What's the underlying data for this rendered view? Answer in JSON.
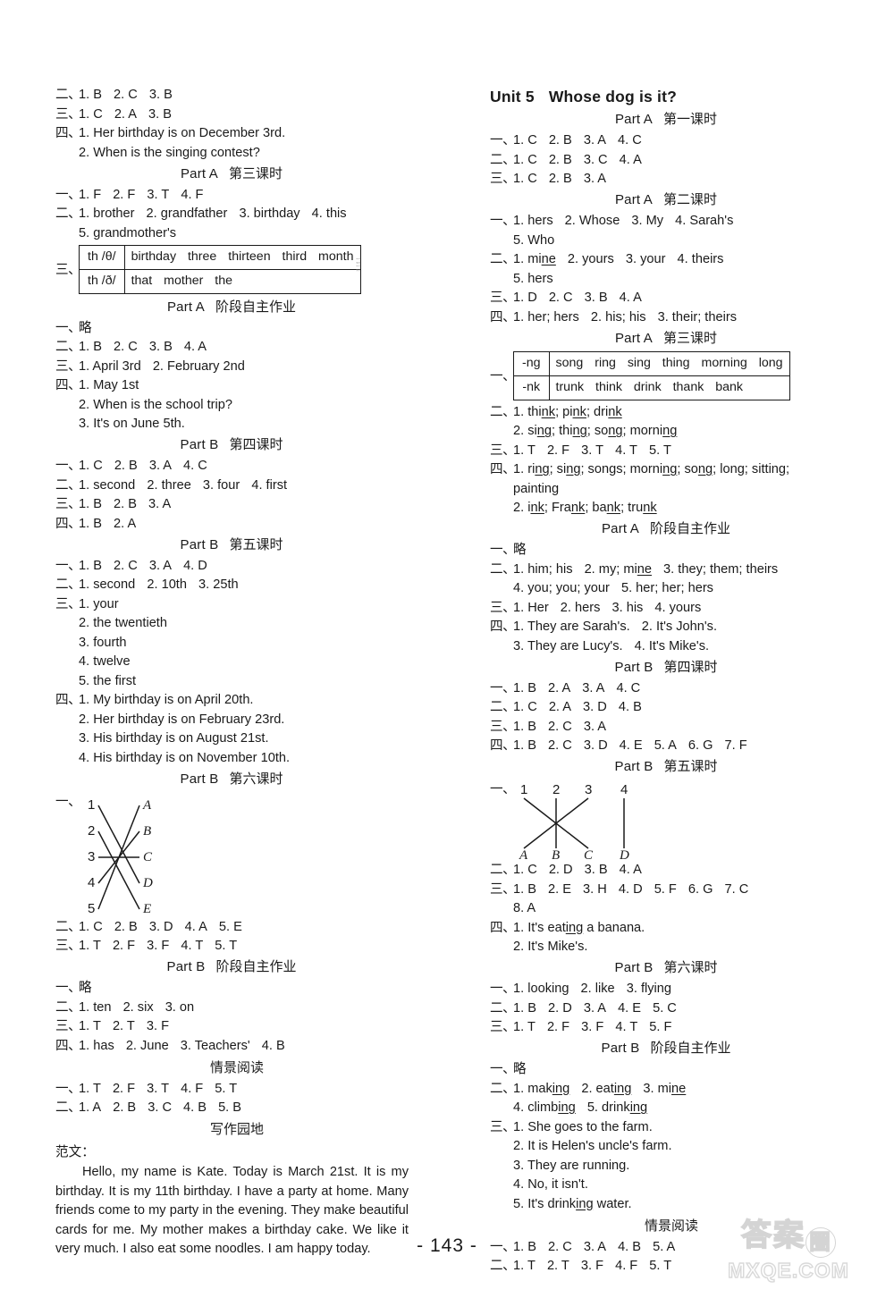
{
  "page": {
    "number": "- 143 -",
    "watermark_cn": "答案",
    "watermark_circle": "圈",
    "watermark_en": "MXQE.COM"
  },
  "left_column": {
    "blocks": [
      {
        "type": "line",
        "num": "二、",
        "text": "1. B  2. C  3. B"
      },
      {
        "type": "line",
        "num": "三、",
        "text": "1. C  2. A  3. B"
      },
      {
        "type": "line",
        "num": "四、",
        "text": "1. Her birthday is on December 3rd."
      },
      {
        "type": "line",
        "num": "",
        "text": "2. When is the singing contest?"
      },
      {
        "type": "part",
        "part": "Part A",
        "cn": "第三课时"
      },
      {
        "type": "line",
        "num": "一、",
        "text": "1. F  2. F  3. T  4. F"
      },
      {
        "type": "line",
        "num": "二、",
        "text": "1. brother  2. grandfather  3. birthday  4. this"
      },
      {
        "type": "line",
        "num": "",
        "text": "5. grandmother's"
      },
      {
        "type": "table",
        "num": "三、",
        "rows": [
          {
            "key": "th /θ/",
            "words": "birthday   three   thirteen   third month"
          },
          {
            "key": "th /ð/",
            "words": "that   mother   the"
          }
        ]
      },
      {
        "type": "part",
        "part": "Part A",
        "cn": "阶段自主作业"
      },
      {
        "type": "line",
        "num": "一、",
        "text": "略"
      },
      {
        "type": "line",
        "num": "二、",
        "text": "1. B  2. C  3. B  4. A"
      },
      {
        "type": "line",
        "num": "三、",
        "text": "1. April 3rd   2. February 2nd"
      },
      {
        "type": "line",
        "num": "四、",
        "text": "1. May 1st"
      },
      {
        "type": "line",
        "num": "",
        "text": "2. When is the school trip?"
      },
      {
        "type": "line",
        "num": "",
        "text": "3. It's on June 5th."
      },
      {
        "type": "part",
        "part": "Part B",
        "cn": "第四课时"
      },
      {
        "type": "line",
        "num": "一、",
        "text": "1. C  2. B  3. A  4. C"
      },
      {
        "type": "line",
        "num": "二、",
        "text": "1. second  2. three  3. four  4. first"
      },
      {
        "type": "line",
        "num": "三、",
        "text": "1. B  2. B  3. A"
      },
      {
        "type": "line",
        "num": "四、",
        "text": "1. B  2. A"
      },
      {
        "type": "part",
        "part": "Part B",
        "cn": "第五课时"
      },
      {
        "type": "line",
        "num": "一、",
        "text": "1. B  2. C  3. A  4. D"
      },
      {
        "type": "line",
        "num": "二、",
        "text": "1. second  2. 10th  3. 25th"
      },
      {
        "type": "line",
        "num": "三、",
        "text": "1. your"
      },
      {
        "type": "line",
        "num": "",
        "text": "2. the twentieth"
      },
      {
        "type": "line",
        "num": "",
        "text": "3. fourth"
      },
      {
        "type": "line",
        "num": "",
        "text": "4. twelve"
      },
      {
        "type": "line",
        "num": "",
        "text": "5. the first"
      },
      {
        "type": "line",
        "num": "四、",
        "text": "1. My birthday is on April 20th."
      },
      {
        "type": "line",
        "num": "",
        "text": "2. Her birthday is on February 23rd."
      },
      {
        "type": "line",
        "num": "",
        "text": "3. His birthday is on August 21st."
      },
      {
        "type": "line",
        "num": "",
        "text": "4. His birthday is on November 10th."
      },
      {
        "type": "part",
        "part": "Part B",
        "cn": "第六课时"
      },
      {
        "type": "match_left",
        "num": "一、"
      },
      {
        "type": "line",
        "num": "二、",
        "text": "1. C  2. B  3. D  4. A  5. E"
      },
      {
        "type": "line",
        "num": "三、",
        "text": "1. T  2. F  3. F  4. T  5. T"
      },
      {
        "type": "part",
        "part": "Part B",
        "cn": "阶段自主作业"
      },
      {
        "type": "line",
        "num": "一、",
        "text": "略"
      },
      {
        "type": "line",
        "num": "二、",
        "text": "1. ten  2. six  3. on"
      },
      {
        "type": "line",
        "num": "三、",
        "text": "1. T  2. T  3. F"
      },
      {
        "type": "line",
        "num": "四、",
        "text": "1. has  2. June  3. Teachers'  4. B"
      },
      {
        "type": "section",
        "title": "情景阅读"
      },
      {
        "type": "line",
        "num": "一、",
        "text": "1. T  2. F  3. T  4. F  5. T"
      },
      {
        "type": "line",
        "num": "二、",
        "text": "1. A  2. B  3. C  4. B  5. B"
      },
      {
        "type": "section",
        "title": "写作园地"
      },
      {
        "type": "fanwen",
        "label": "范文："
      },
      {
        "type": "essay",
        "text": "Hello, my name is Kate. Today is March 21st. It is my birthday. It is my 11th birthday. I have a party at home. Many friends come to my party in the evening. They make beautiful cards for me. My mother makes a birthday cake. We like it very much. I also eat some noodles. I am happy today."
      }
    ]
  },
  "right_column": {
    "unit": {
      "label": "Unit 5",
      "name": "Whose dog is it?"
    },
    "blocks": [
      {
        "type": "part",
        "part": "Part A",
        "cn": "第一课时"
      },
      {
        "type": "line",
        "num": "一、",
        "text": "1. C  2. B  3. A  4. C"
      },
      {
        "type": "line",
        "num": "二、",
        "text": "1. C  2. B  3. C  4. A"
      },
      {
        "type": "line",
        "num": "三、",
        "text": "1. C  2. B  3. A"
      },
      {
        "type": "part",
        "part": "Part A",
        "cn": "第二课时"
      },
      {
        "type": "line",
        "num": "一、",
        "text": "1. hers  2. Whose  3. My  4. Sarah's"
      },
      {
        "type": "line",
        "num": "",
        "text": "5. Who"
      },
      {
        "type": "line",
        "num": "二、",
        "text": "1. mine  2. yours  3. your  4. theirs"
      },
      {
        "type": "line",
        "num": "",
        "text": "5. hers"
      },
      {
        "type": "line",
        "num": "三、",
        "text": "1. D  2. C  3. B  4. A"
      },
      {
        "type": "line",
        "num": "四、",
        "text": "1. her; hers  2. his; his  3. their; theirs"
      },
      {
        "type": "part",
        "part": "Part A",
        "cn": "第三课时"
      },
      {
        "type": "table",
        "num": "一、",
        "rows": [
          {
            "key": "-ng",
            "words": "song  ring  sing  thing  morning  long"
          },
          {
            "key": "-nk",
            "words": "trunk  think  drink  thank  bank"
          }
        ]
      },
      {
        "type": "line",
        "num": "二、",
        "text": "1. think; pink; drink"
      },
      {
        "type": "line",
        "num": "",
        "text": "2. sing; thing; song; morning"
      },
      {
        "type": "line",
        "num": "三、",
        "text": "1. T  2. F  3. T  4. T  5. T"
      },
      {
        "type": "line",
        "num": "四、",
        "text": "1. ring; sing; songs; morning; song; long; sitting;"
      },
      {
        "type": "line",
        "num": "",
        "text": "painting"
      },
      {
        "type": "line",
        "num": "",
        "text": "2. ink; Frank; bank; trunk"
      },
      {
        "type": "part",
        "part": "Part A",
        "cn": "阶段自主作业"
      },
      {
        "type": "line",
        "num": "一、",
        "text": "略"
      },
      {
        "type": "line",
        "num": "二、",
        "text": "1. him; his  2. my; mine  3. they; them; theirs"
      },
      {
        "type": "line",
        "num": "",
        "text": "4. you; you; your  5. her; her; hers"
      },
      {
        "type": "line",
        "num": "三、",
        "text": "1. Her  2. hers  3. his  4. yours"
      },
      {
        "type": "line",
        "num": "四、",
        "text": "1. They are Sarah's.  2. It's John's."
      },
      {
        "type": "line",
        "num": "",
        "text": "3. They are Lucy's.  4. It's Mike's."
      },
      {
        "type": "part",
        "part": "Part B",
        "cn": "第四课时"
      },
      {
        "type": "line",
        "num": "一、",
        "text": "1. B  2. A  3. A  4. C"
      },
      {
        "type": "line",
        "num": "二、",
        "text": "1. C  2. A  3. D  4. B"
      },
      {
        "type": "line",
        "num": "三、",
        "text": "1. B  2. C  3. A"
      },
      {
        "type": "line",
        "num": "四、",
        "text": "1. B  2. C  3. D  4. E  5. A  6. G  7. F"
      },
      {
        "type": "part",
        "part": "Part B",
        "cn": "第五课时"
      },
      {
        "type": "match_right",
        "num": "一、"
      },
      {
        "type": "line",
        "num": "二、",
        "text": "1. C  2. D  3. B  4. A"
      },
      {
        "type": "line",
        "num": "三、",
        "text": "1. B  2. E  3. H  4. D  5. F  6. G  7. C"
      },
      {
        "type": "line",
        "num": "",
        "text": "8. A"
      },
      {
        "type": "line",
        "num": "四、",
        "text": "1. It's eating a banana."
      },
      {
        "type": "line",
        "num": "",
        "text": "2. It's Mike's."
      },
      {
        "type": "part",
        "part": "Part B",
        "cn": "第六课时"
      },
      {
        "type": "line",
        "num": "一、",
        "text": "1. looking  2. like  3. flying"
      },
      {
        "type": "line",
        "num": "二、",
        "text": "1. B  2. D  3. A  4. E  5. C"
      },
      {
        "type": "line",
        "num": "三、",
        "text": "1. T  2. F  3. F  4. T  5. F"
      },
      {
        "type": "part",
        "part": "Part B",
        "cn": "阶段自主作业"
      },
      {
        "type": "line",
        "num": "一、",
        "text": "略"
      },
      {
        "type": "line",
        "num": "二、",
        "text": "1. making  2. eating  3. mine"
      },
      {
        "type": "line",
        "num": "",
        "text": "4. climbing  5. drinking"
      },
      {
        "type": "line",
        "num": "三、",
        "text": "1. She goes to the farm."
      },
      {
        "type": "line",
        "num": "",
        "text": "2. It is Helen's uncle's farm."
      },
      {
        "type": "line",
        "num": "",
        "text": "3. They are running."
      },
      {
        "type": "line",
        "num": "",
        "text": "4. No, it isn't."
      },
      {
        "type": "line",
        "num": "",
        "text": "5. It's drinking water."
      },
      {
        "type": "section",
        "title": "情景阅读"
      },
      {
        "type": "line",
        "num": "一、",
        "text": "1. B  2. C  3. A  4. B  5. A"
      },
      {
        "type": "line",
        "num": "二、",
        "text": "1. T  2. T  3. F  4. F  5. T"
      }
    ]
  },
  "match_left": {
    "left_labels": [
      "1",
      "2",
      "3",
      "4",
      "5"
    ],
    "right_labels": [
      "A",
      "B",
      "C",
      "D",
      "E"
    ],
    "pairs": [
      {
        "from": "1",
        "to": "D"
      },
      {
        "from": "2",
        "to": "E"
      },
      {
        "from": "3",
        "to": "C"
      },
      {
        "from": "4",
        "to": "B"
      },
      {
        "from": "5",
        "to": "A"
      }
    ]
  },
  "match_right": {
    "top_labels": [
      "1",
      "2",
      "3",
      "4"
    ],
    "bottom_labels": [
      "A",
      "B",
      "C",
      "D"
    ],
    "pairs": [
      {
        "from": "1",
        "to": "C"
      },
      {
        "from": "2",
        "to": "B"
      },
      {
        "from": "3",
        "to": "A"
      },
      {
        "from": "4",
        "to": "D"
      }
    ]
  }
}
